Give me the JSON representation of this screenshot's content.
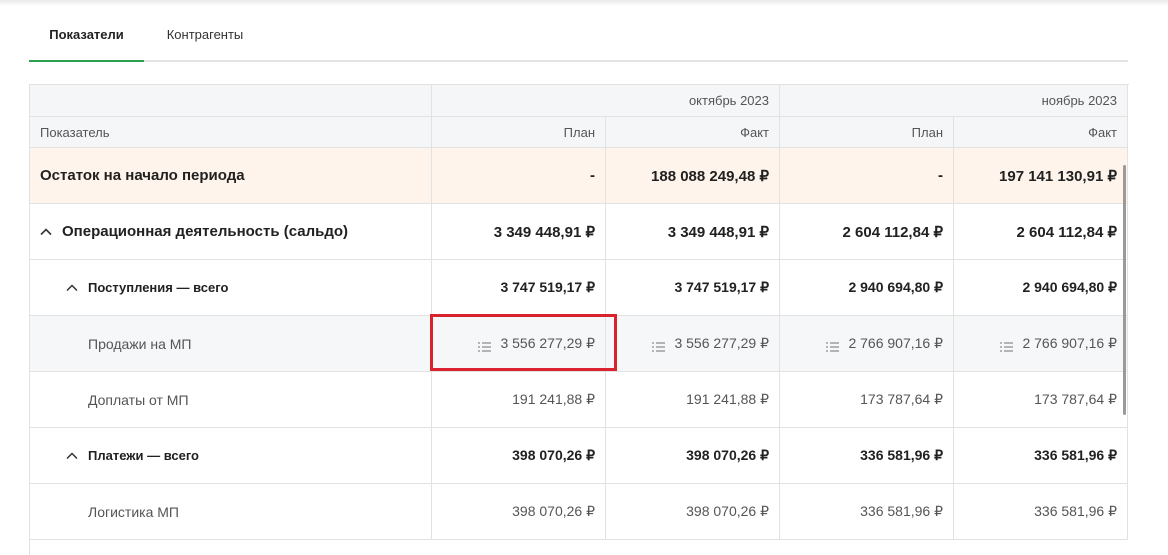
{
  "tabs": [
    {
      "label": "Показатели",
      "active": true
    },
    {
      "label": "Контрагенты",
      "active": false
    }
  ],
  "table": {
    "months": [
      "октябрь 2023",
      "ноябрь 2023"
    ],
    "header": {
      "indicator": "Показатель",
      "plan": "План",
      "fact": "Факт"
    },
    "rows": [
      {
        "label": "Остаток на начало периода",
        "values": [
          "-",
          "188 088 249,48 ₽",
          "-",
          "197 141 130,91 ₽"
        ]
      },
      {
        "label": "Операционная деятельность (сальдо)",
        "values": [
          "3 349 448,91 ₽",
          "3 349 448,91 ₽",
          "2 604 112,84 ₽",
          "2 604 112,84 ₽"
        ]
      },
      {
        "label": "Поступления — всего",
        "values": [
          "3 747 519,17 ₽",
          "3 747 519,17 ₽",
          "2 940 694,80 ₽",
          "2 940 694,80 ₽"
        ]
      },
      {
        "label": "Продажи на МП",
        "values": [
          "3 556 277,29 ₽",
          "3 556 277,29 ₽",
          "2 766 907,16 ₽",
          "2 766 907,16 ₽"
        ]
      },
      {
        "label": "Доплаты от МП",
        "values": [
          "191 241,88 ₽",
          "191 241,88 ₽",
          "173 787,64 ₽",
          "173 787,64 ₽"
        ]
      },
      {
        "label": "Платежи — всего",
        "values": [
          "398 070,26 ₽",
          "398 070,26 ₽",
          "336 581,96 ₽",
          "336 581,96 ₽"
        ]
      },
      {
        "label": "Логистика МП",
        "values": [
          "398 070,26 ₽",
          "398 070,26 ₽",
          "336 581,96 ₽",
          "336 581,96 ₽"
        ]
      }
    ]
  },
  "colors": {
    "accent": "#2e9e4f",
    "highlight": "#d9232e",
    "peach": "#fef4eb"
  }
}
